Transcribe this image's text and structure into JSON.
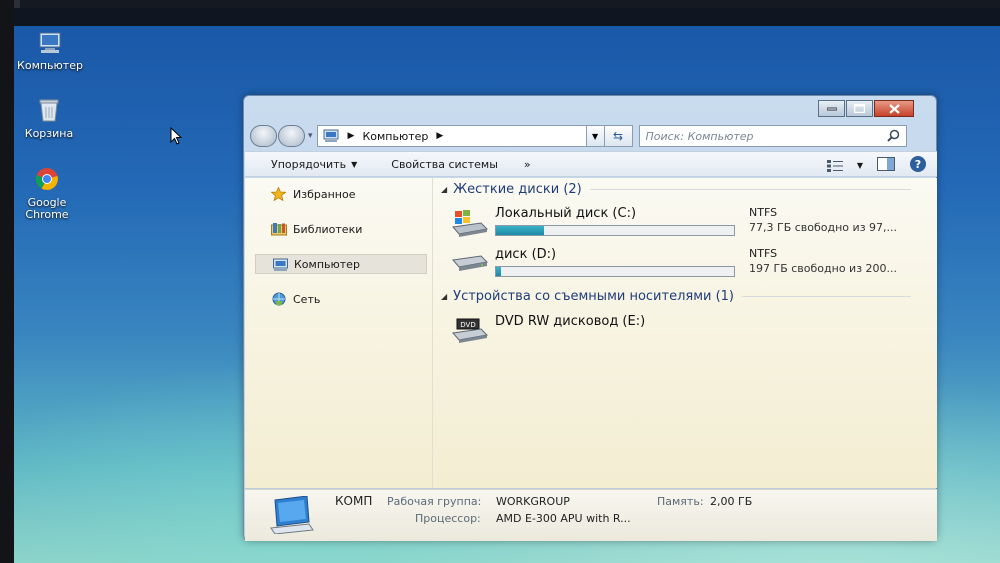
{
  "desktop": {
    "icons": [
      {
        "label": "Компьютер"
      },
      {
        "label": "Корзина"
      },
      {
        "label_line1": "Google",
        "label_line2": "Chrome"
      }
    ]
  },
  "explorer": {
    "breadcrumb": [
      "Компьютер"
    ],
    "search_placeholder": "Поиск: Компьютер",
    "commands": {
      "organize": "Упорядочить",
      "system_properties": "Свойства системы",
      "more": "»"
    },
    "nav": {
      "favorites": "Избранное",
      "libraries": "Библиотеки",
      "computer": "Компьютер",
      "network": "Сеть"
    },
    "groups": {
      "hard_drives": "Жесткие диски (2)",
      "removable": "Устройства со съемными носителями (1)"
    },
    "drives": [
      {
        "name": "Локальный диск (C:)",
        "fs": "NTFS",
        "free": "77,3 ГБ свободно из 97,...",
        "used_fraction": 0.2
      },
      {
        "name": "диск (D:)",
        "fs": "NTFS",
        "free": "197 ГБ свободно из 200...",
        "used_fraction": 0.02
      }
    ],
    "removable": [
      {
        "name": "DVD RW дисковод (E:)"
      }
    ],
    "details": {
      "computer_name": "КОМП",
      "workgroup_label": "Рабочая группа:",
      "workgroup": "WORKGROUP",
      "memory_label": "Память:",
      "memory": "2,00 ГБ",
      "processor_label": "Процессор:",
      "processor": "AMD E-300 APU with R..."
    }
  },
  "colors": {
    "accent": "#1f3d7a",
    "usage_bar": "#1d8aa7",
    "close_button": "#c6422a"
  }
}
